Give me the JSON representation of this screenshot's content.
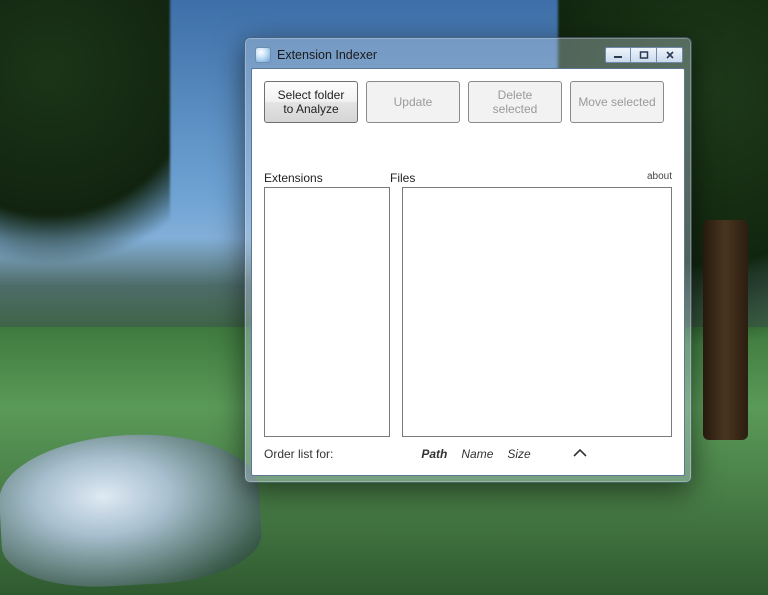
{
  "window": {
    "title": "Extension Indexer"
  },
  "toolbar": {
    "select_folder": "Select folder to Analyze",
    "update": "Update",
    "delete_selected": "Delete selected",
    "move_selected": "Move selected"
  },
  "labels": {
    "extensions": "Extensions",
    "files": "Files",
    "about": "about",
    "order_list_for": "Order list for:"
  },
  "order_options": {
    "path": "Path",
    "name": "Name",
    "size": "Size"
  },
  "extensions_list": [],
  "files_list": []
}
